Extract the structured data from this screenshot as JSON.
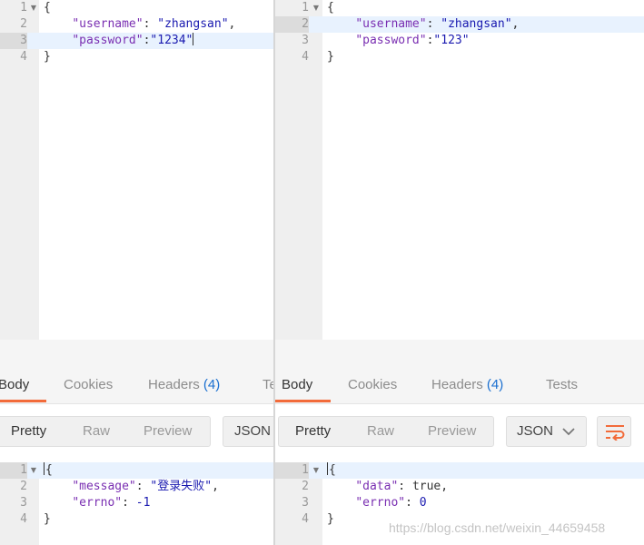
{
  "left_request": {
    "lines": [
      {
        "num": "1",
        "text": "{"
      },
      {
        "num": "2",
        "key": "\"username\"",
        "sep": ": ",
        "val": "\"zhangsan\"",
        "tail": ","
      },
      {
        "num": "3",
        "key": "\"password\"",
        "sep": ":",
        "val": "\"1234\""
      },
      {
        "num": "4",
        "text": "}"
      }
    ]
  },
  "right_request": {
    "lines": [
      {
        "num": "1",
        "text": "{"
      },
      {
        "num": "2",
        "key": "\"username\"",
        "sep": ": ",
        "val": "\"zhangsan\"",
        "tail": ","
      },
      {
        "num": "3",
        "key": "\"password\"",
        "sep": ":",
        "val": "\"123\""
      },
      {
        "num": "4",
        "text": "}"
      }
    ]
  },
  "left_tabs": {
    "body": "Body",
    "cookies": "Cookies",
    "headers": "Headers",
    "headers_count": "(4)",
    "tests": "Tests"
  },
  "right_tabs": {
    "body": "Body",
    "cookies": "Cookies",
    "headers": "Headers",
    "headers_count": "(4)",
    "tests": "Tests"
  },
  "left_toolbar": {
    "pretty": "Pretty",
    "raw": "Raw",
    "preview": "Preview",
    "format": "JSON"
  },
  "right_toolbar": {
    "pretty": "Pretty",
    "raw": "Raw",
    "preview": "Preview",
    "format": "JSON"
  },
  "left_response": {
    "lines": [
      {
        "num": "1",
        "text": "{"
      },
      {
        "num": "2",
        "key": "\"message\"",
        "sep": ": ",
        "val": "\"登录失败\"",
        "tail": ","
      },
      {
        "num": "3",
        "key": "\"errno\"",
        "sep": ": ",
        "val": "-1"
      },
      {
        "num": "4",
        "text": "}"
      }
    ]
  },
  "right_response": {
    "lines": [
      {
        "num": "1",
        "text": "{"
      },
      {
        "num": "2",
        "key": "\"data\"",
        "sep": ": ",
        "val": "true",
        "tail": ","
      },
      {
        "num": "3",
        "key": "\"errno\"",
        "sep": ": ",
        "val": "0"
      },
      {
        "num": "4",
        "text": "}"
      }
    ]
  },
  "watermark": "https://blog.csdn.net/weixin_44659458",
  "icons": {
    "fold": "fold-arrow-icon",
    "dropdown": "chevron-down-icon",
    "wrap": "wrap-lines-icon"
  },
  "colors": {
    "accent": "#f26b3a",
    "key": "#7a2fb2",
    "string": "#1a1ab0",
    "active_line": "#e8f2fe"
  }
}
